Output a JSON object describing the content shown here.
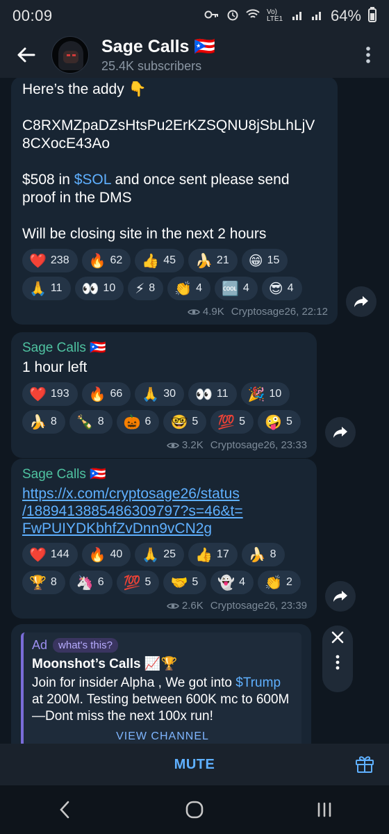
{
  "status": {
    "time": "00:09",
    "network": "Vo) LTE1",
    "battery": "64%"
  },
  "header": {
    "title": "Sage Calls 🇵🇷",
    "subscribers": "25.4K subscribers"
  },
  "messages": [
    {
      "text_lines": [
        "Here’s the addy 👇",
        "",
        "C8RXMZpaDZsHtsPu2ErKZSQNU8jSbLhLjV",
        "8CXocE43Ao",
        ""
      ],
      "price_before": "$508 in ",
      "price_link": "$SOL",
      "price_after": " and once sent please send",
      "line_after": "proof in the DMS",
      "closing": "Will be closing site in the next 2 hours",
      "reactions": [
        {
          "emoji": "❤️",
          "count": "238"
        },
        {
          "emoji": "🔥",
          "count": "62"
        },
        {
          "emoji": "👍",
          "count": "45"
        },
        {
          "emoji": "🍌",
          "count": "21"
        },
        {
          "emoji": "😁",
          "count": "15"
        },
        {
          "emoji": "🙏",
          "count": "11"
        },
        {
          "emoji": "👀",
          "count": "10"
        },
        {
          "emoji": "⚡",
          "count": "8"
        },
        {
          "emoji": "👏",
          "count": "4"
        },
        {
          "emoji": "🆒",
          "count": "4"
        },
        {
          "emoji": "😎",
          "count": "4"
        }
      ],
      "views": "4.9K",
      "author_time": "Cryptosage26, 22:12"
    },
    {
      "sender": "Sage Calls 🇵🇷",
      "text": "1 hour left",
      "reactions": [
        {
          "emoji": "❤️",
          "count": "193"
        },
        {
          "emoji": "🔥",
          "count": "66"
        },
        {
          "emoji": "🙏",
          "count": "30"
        },
        {
          "emoji": "👀",
          "count": "11"
        },
        {
          "emoji": "🎉",
          "count": "10"
        },
        {
          "emoji": "🍌",
          "count": "8"
        },
        {
          "emoji": "🍾",
          "count": "8"
        },
        {
          "emoji": "🎃",
          "count": "6"
        },
        {
          "emoji": "🤓",
          "count": "5"
        },
        {
          "emoji": "💯",
          "count": "5"
        },
        {
          "emoji": "🤪",
          "count": "5"
        }
      ],
      "views": "3.2K",
      "author_time": "Cryptosage26, 23:33"
    },
    {
      "sender": "Sage Calls 🇵🇷",
      "url_lines": [
        "https://x.com/cryptosage26/status",
        "/1889413885486309797?s=46&t=",
        "FwPUIYDKbhfZvDnn9vCN2g"
      ],
      "reactions": [
        {
          "emoji": "❤️",
          "count": "144"
        },
        {
          "emoji": "🔥",
          "count": "40"
        },
        {
          "emoji": "🙏",
          "count": "25"
        },
        {
          "emoji": "👍",
          "count": "17"
        },
        {
          "emoji": "🍌",
          "count": "8"
        },
        {
          "emoji": "🏆",
          "count": "8"
        },
        {
          "emoji": "🦄",
          "count": "6"
        },
        {
          "emoji": "💯",
          "count": "5"
        },
        {
          "emoji": "🤝",
          "count": "5"
        },
        {
          "emoji": "👻",
          "count": "4"
        },
        {
          "emoji": "👏",
          "count": "2"
        }
      ],
      "views": "2.6K",
      "author_time": "Cryptosage26, 23:39"
    }
  ],
  "ad": {
    "label": "Ad",
    "whats_this": "what's this?",
    "title": "Moonshot’s Calls 📈🏆",
    "body_before": "Join for insider Alpha , We got into ",
    "body_link": "$Trump",
    "body_after": " at 200M. Testing between 600K mc to  600M—Dont miss the next 100x run!",
    "cta": "VIEW CHANNEL"
  },
  "bottom": {
    "mute_label": "MUTE"
  },
  "colors": {
    "accent": "#5fb0ff",
    "sender": "#4fc3a1",
    "bubble": "#182533"
  }
}
